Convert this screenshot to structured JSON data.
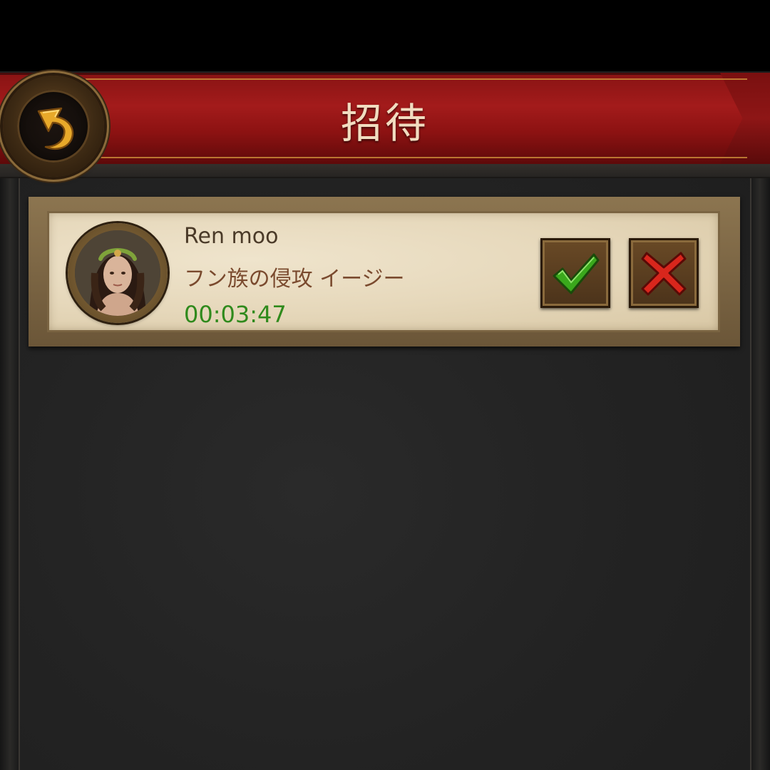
{
  "header": {
    "title": "招待",
    "back_icon": "back-arrow-icon"
  },
  "invitations": [
    {
      "player_name": "Ren moo",
      "event_name": "フン族の侵攻 イージー",
      "countdown": "00:03:47",
      "accept_icon": "checkmark-icon",
      "decline_icon": "close-icon"
    }
  ],
  "colors": {
    "banner_red": "#a31b1b",
    "title_text": "#f1dcc0",
    "timer_green": "#2f8a1c",
    "event_text": "#7a4a2e",
    "accept_green": "#3aa81c",
    "decline_red": "#d8261c"
  }
}
